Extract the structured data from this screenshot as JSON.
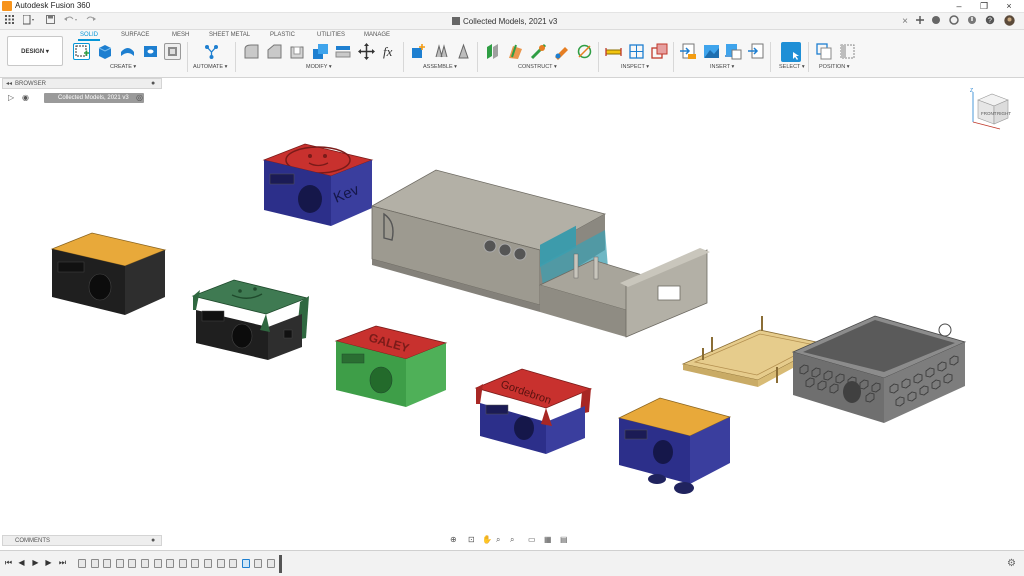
{
  "app": {
    "title": "Autodesk Fusion 360",
    "document_tab": "Collected Models, 2021 v3"
  },
  "window_controls": {
    "minimize": "–",
    "maximize": "❐",
    "close": "×"
  },
  "workspace_tabs": [
    "SOLID",
    "SURFACE",
    "MESH",
    "SHEET METAL",
    "PLASTIC",
    "UTILITIES",
    "MANAGE"
  ],
  "active_tab": "SOLID",
  "design_button": "DESIGN ▾",
  "toolbar_groups": [
    "CREATE ▾",
    "AUTOMATE ▾",
    "MODIFY ▾",
    "ASSEMBLE ▾",
    "CONSTRUCT ▾",
    "INSPECT ▾",
    "INSERT ▾",
    "SELECT ▾",
    "POSITION ▾"
  ],
  "colors": {
    "accent": "#0696d7",
    "navy": "#2c2f8a",
    "orange": "#e9a63a",
    "green": "#3e9e48",
    "red": "#c8312e",
    "gray_body": "#a6a39a",
    "dark": "#1f1f1f"
  },
  "browser": {
    "header": "BROWSER",
    "root_item": "Collected Models, 2021 v3"
  },
  "comments": {
    "header": "COMMENTS"
  },
  "model_labels": {
    "kev": "Kev",
    "galey": "GALEY",
    "gordebron": "Gordebron"
  },
  "viewcube": {
    "top": "Z",
    "front": "FRONT",
    "right": "RIGHT",
    "axis_y": "Y",
    "axis_x": "X"
  },
  "timeline": {
    "feature_count": 16
  }
}
